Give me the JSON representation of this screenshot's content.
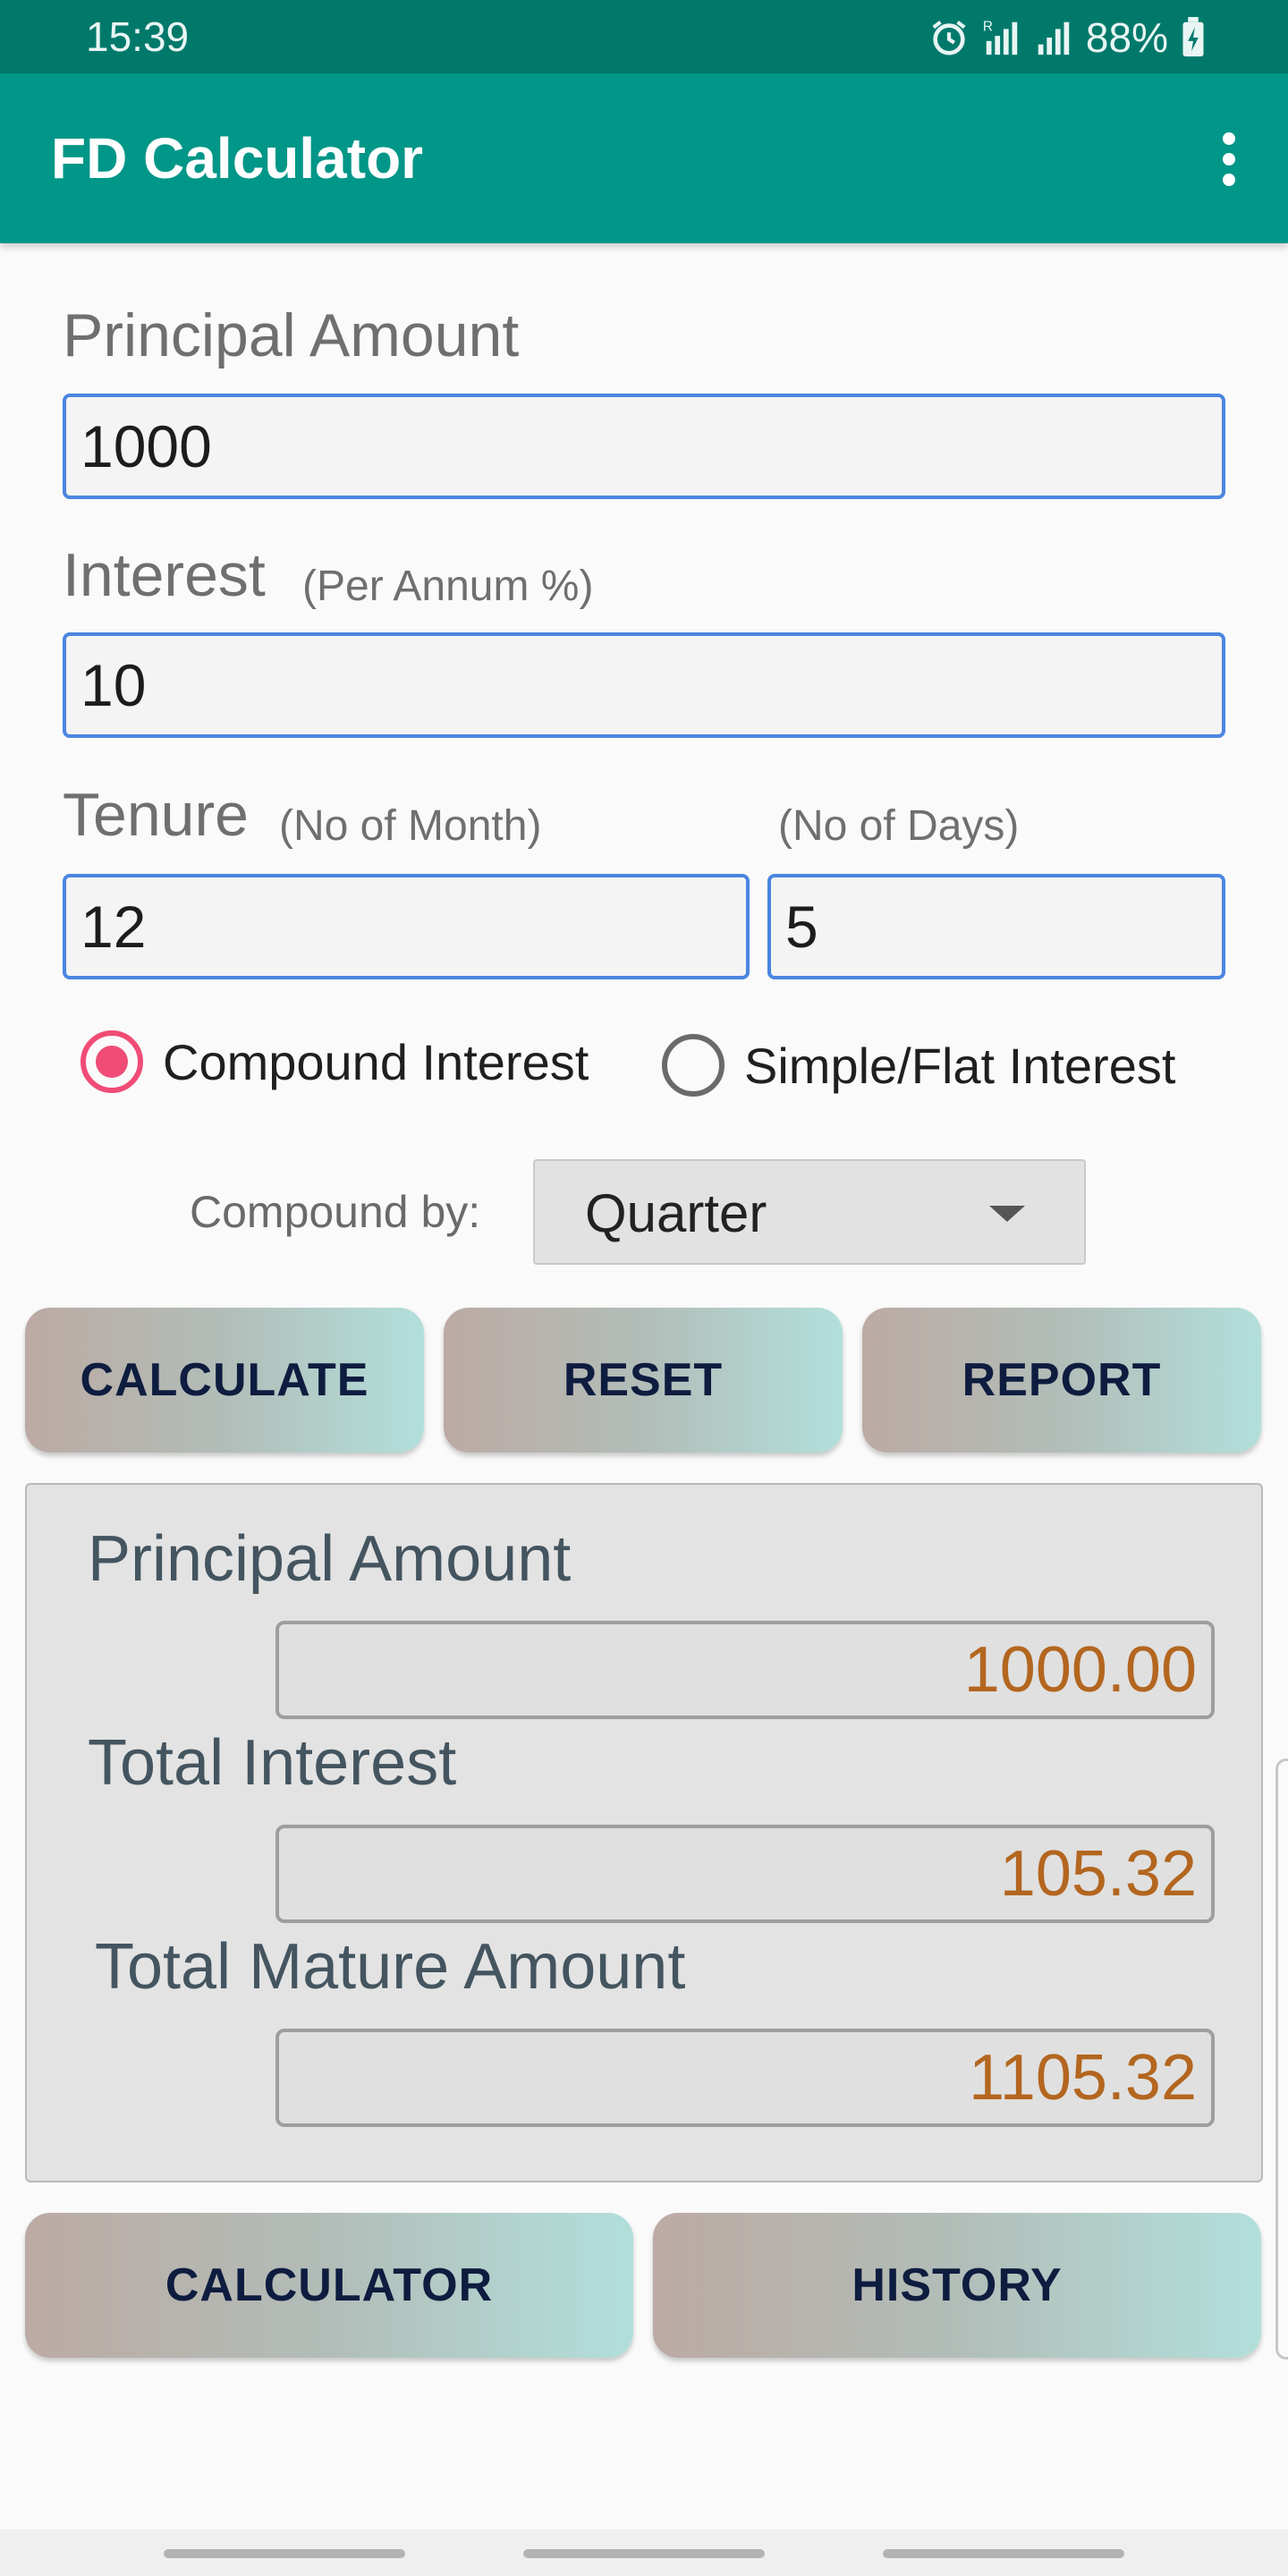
{
  "status_bar": {
    "time": "15:39",
    "battery": "88%",
    "icons": [
      "alarm-icon",
      "signal-roaming-icon",
      "signal-icon",
      "battery-charging-icon"
    ]
  },
  "app_bar": {
    "title": "FD Calculator",
    "menu_icon": "more-vert-icon",
    "color": "#009688"
  },
  "form": {
    "principal": {
      "label": "Principal Amount",
      "value": "1000"
    },
    "interest": {
      "label": "Interest",
      "sublabel": "(Per Annum %)",
      "value": "10"
    },
    "tenure": {
      "label": "Tenure",
      "months_sublabel": "(No of Month)",
      "days_sublabel": "(No of Days)",
      "months_value": "12",
      "days_value": "5"
    },
    "interest_type": {
      "options": [
        {
          "label": "Compound Interest",
          "checked": true
        },
        {
          "label": "Simple/Flat Interest",
          "checked": false
        }
      ]
    },
    "compound_by": {
      "label": "Compound by:",
      "selected": "Quarter"
    }
  },
  "actions": {
    "calculate": "CALCULATE",
    "reset": "RESET",
    "report": "REPORT"
  },
  "results": {
    "principal_label": "Principal Amount",
    "principal_value": "1000.00",
    "interest_label": "Total Interest",
    "interest_value": "105.32",
    "maturity_label": "Total Mature Amount",
    "maturity_value": "1105.32",
    "value_color": "#b3661f"
  },
  "bottom_buttons": {
    "calculator": "CALCULATOR",
    "history": "HISTORY"
  },
  "colors": {
    "accent_radio": "#f04c76",
    "input_border": "#4a86e0",
    "button_text": "#0e1c3f"
  }
}
